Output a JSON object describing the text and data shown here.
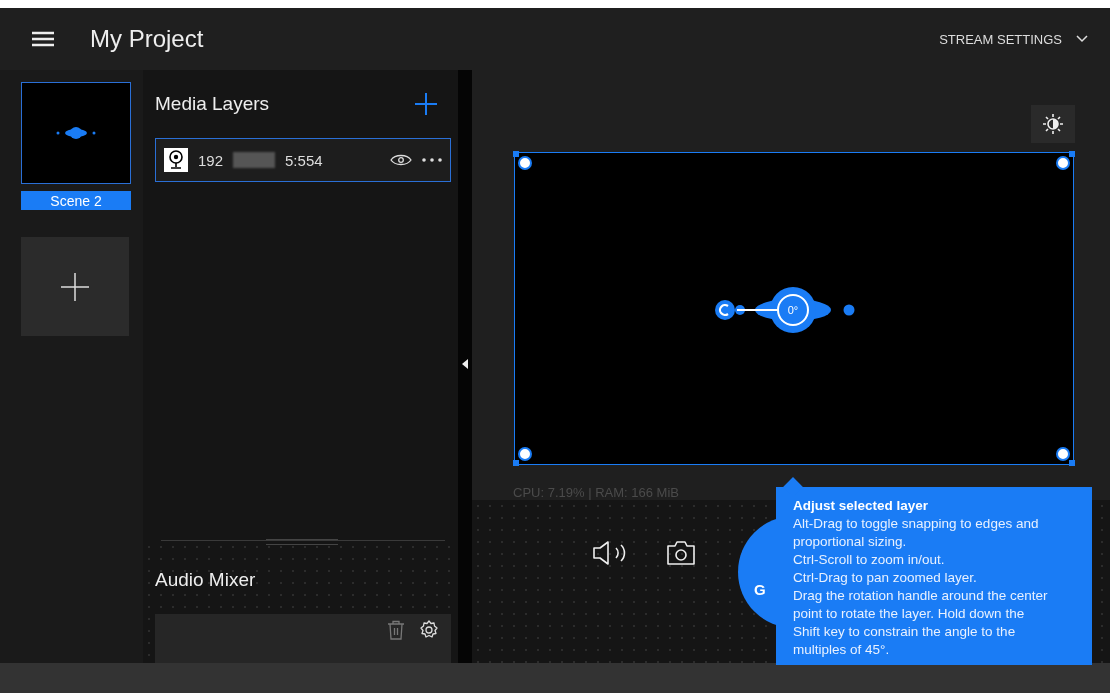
{
  "header": {
    "title": "My Project",
    "stream_settings": "STREAM SETTINGS"
  },
  "scenes": [
    {
      "label": "Scene 2",
      "selected": true
    }
  ],
  "media_layers": {
    "title": "Media Layers",
    "layers": [
      {
        "address_start": "192",
        "address_end": "5:554",
        "selected": true
      }
    ]
  },
  "audio_mixer": {
    "title": "Audio Mixer"
  },
  "preview": {
    "rotation": "0°",
    "stats": "CPU: 7.19% | RAM: 166 MiB"
  },
  "go_button": {
    "label": "G"
  },
  "tooltip": {
    "title": "Adjust selected layer",
    "lines": [
      "Alt-Drag to toggle snapping to edges and proportional sizing.",
      "Ctrl-Scroll to zoom in/out.",
      "Ctrl-Drag to pan zoomed layer.",
      "Drag the rotation handle around the center point to rotate the layer. Hold down the Shift key to constrain the angle to the multiples of 45°."
    ]
  }
}
